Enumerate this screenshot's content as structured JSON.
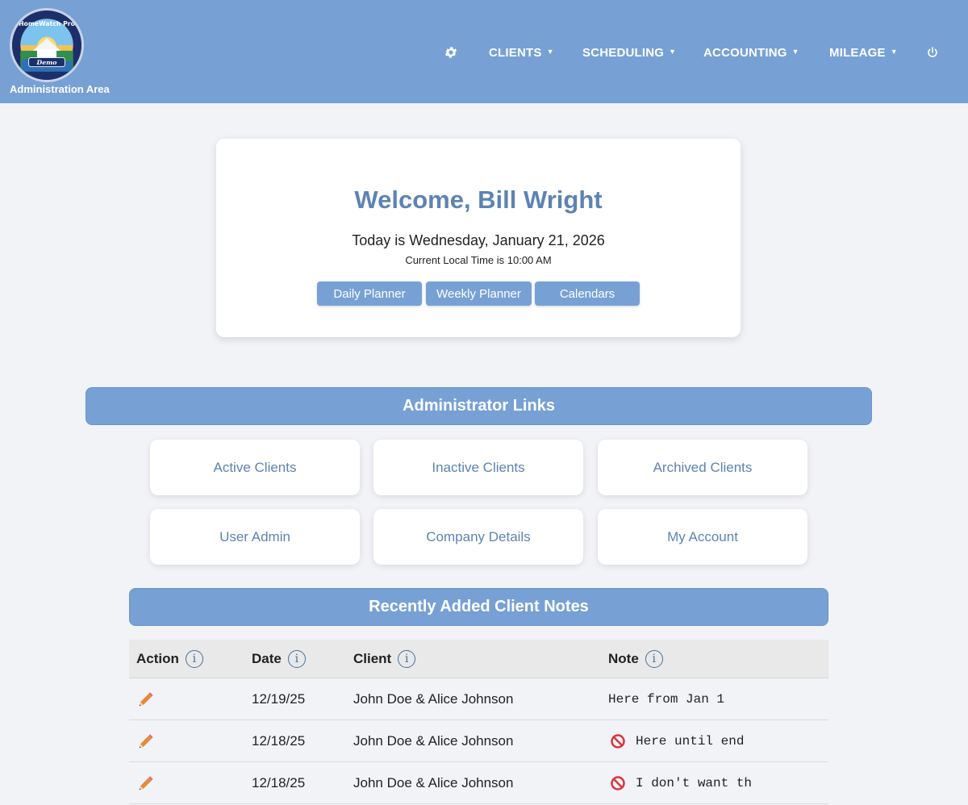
{
  "header": {
    "logo": {
      "brand": "HomeWatch Pro",
      "badge": "Demo"
    },
    "area_label": "Administration Area",
    "nav": [
      {
        "label": "CLIENTS"
      },
      {
        "label": "SCHEDULING"
      },
      {
        "label": "ACCOUNTING"
      },
      {
        "label": "MILEAGE"
      }
    ],
    "icons": {
      "settings": "gear-icon",
      "logout": "power-icon"
    }
  },
  "welcome": {
    "title": "Welcome, Bill Wright",
    "today": "Today is Wednesday, January 21, 2026",
    "time": "Current Local Time is 10:00 AM",
    "buttons": [
      "Daily Planner",
      "Weekly Planner",
      "Calendars"
    ]
  },
  "admin_links": {
    "title": "Administrator Links",
    "items": [
      "Active Clients",
      "Inactive Clients",
      "Archived Clients",
      "User Admin",
      "Company Details",
      "My Account"
    ]
  },
  "notes": {
    "title": "Recently Added Client Notes",
    "columns": [
      "Action",
      "Date",
      "Client",
      "Note"
    ],
    "info_glyph": "i",
    "rows": [
      {
        "date": "12/19/25",
        "client": "John Doe & Alice Johnson",
        "note": "Here from Jan 1",
        "blocked": false
      },
      {
        "date": "12/18/25",
        "client": "John Doe & Alice Johnson",
        "note": "Here until end",
        "blocked": true
      },
      {
        "date": "12/18/25",
        "client": "John Doe & Alice Johnson",
        "note": "I don't want th",
        "blocked": true
      }
    ]
  },
  "colors": {
    "header_bg": "#77a1d5",
    "accent_text": "#5d83b3",
    "page_bg": "#f2f3f7"
  }
}
